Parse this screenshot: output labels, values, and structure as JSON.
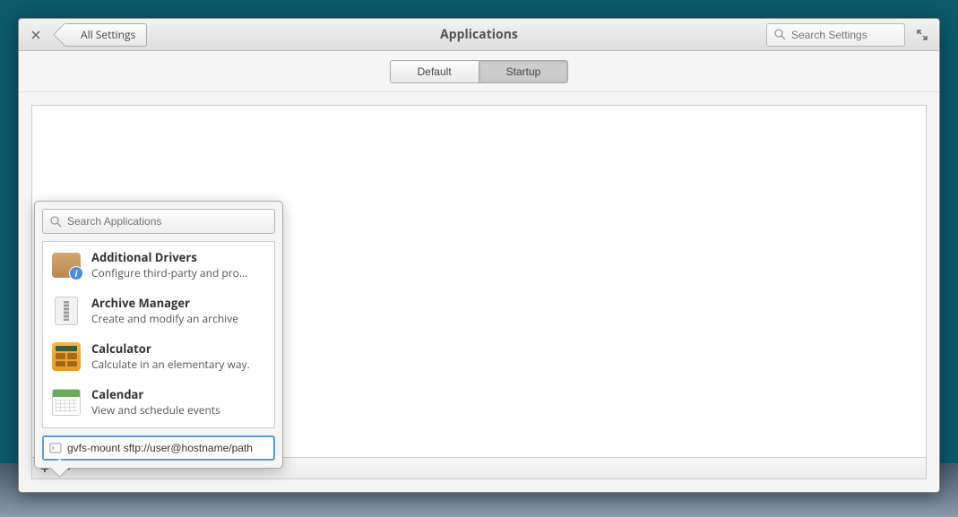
{
  "window": {
    "title": "Applications",
    "back_label": "All Settings",
    "search_placeholder": "Search Settings"
  },
  "tabs": {
    "default": "Default",
    "startup": "Startup"
  },
  "popover": {
    "search_placeholder": "Search Applications",
    "custom_command_value": "gvfs-mount sftp://user@hostname/path",
    "apps": [
      {
        "name": "Additional Drivers",
        "desc": "Configure third-party and pro…",
        "icon": "drivers"
      },
      {
        "name": "Archive Manager",
        "desc": "Create and modify an archive",
        "icon": "archive"
      },
      {
        "name": "Calculator",
        "desc": "Calculate in an elementary way.",
        "icon": "calculator"
      },
      {
        "name": "Calendar",
        "desc": "View and schedule events",
        "icon": "calendar"
      }
    ]
  },
  "actions": {
    "add": "+",
    "remove": "−"
  }
}
